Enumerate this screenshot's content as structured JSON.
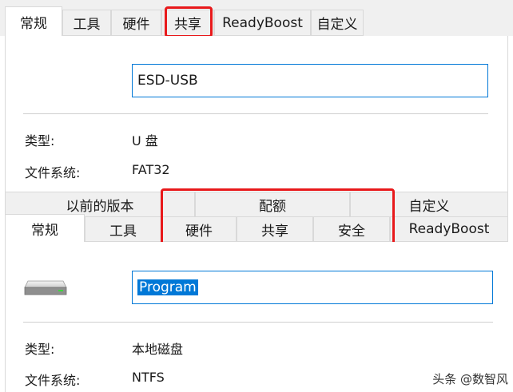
{
  "top_panel": {
    "tabs": [
      "常规",
      "工具",
      "硬件",
      "共享",
      "ReadyBoost",
      "自定义"
    ],
    "selected_tab": "常规",
    "highlighted_tab": "共享",
    "name_field_value": "ESD-USB",
    "properties": [
      {
        "label": "类型:",
        "value": "U 盘"
      },
      {
        "label": "文件系统:",
        "value": "FAT32"
      }
    ]
  },
  "bottom_panel": {
    "tabs_row1": [
      "以前的版本",
      "配额",
      "自定义"
    ],
    "tabs_row2": [
      "常规",
      "工具",
      "硬件",
      "共享",
      "安全",
      "ReadyBoost"
    ],
    "selected_tab": "常规",
    "highlighted_tabs": [
      "配额",
      "硬件",
      "共享",
      "安全"
    ],
    "drive_icon": "hard-drive-icon",
    "name_field_value": "Program",
    "properties": [
      {
        "label": "类型:",
        "value": "本地磁盘"
      },
      {
        "label": "文件系统:",
        "value": "NTFS"
      }
    ]
  },
  "watermark": {
    "text": "头条 @数智风"
  },
  "colors": {
    "highlight": "#e8191b",
    "selection": "#0078d7",
    "input_border": "#0078d7"
  }
}
